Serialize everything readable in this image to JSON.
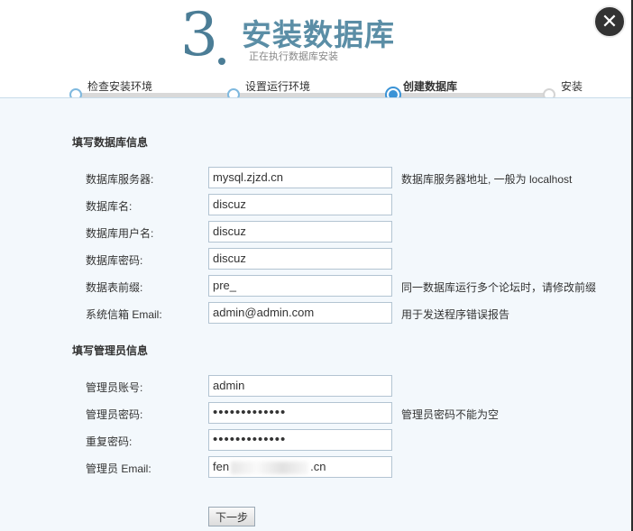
{
  "header": {
    "step_number": "3",
    "title": "安装数据库",
    "subtitle": "正在执行数据库安装",
    "close_icon": "close-icon"
  },
  "steps": [
    {
      "label": "检查安装环境",
      "state": "done"
    },
    {
      "label": "设置运行环境",
      "state": "done"
    },
    {
      "label": "创建数据库",
      "state": "current"
    },
    {
      "label": "安装",
      "state": "todo"
    }
  ],
  "db_section": {
    "title": "填写数据库信息",
    "fields": [
      {
        "label": "数据库服务器:",
        "value": "mysql.zjzd.cn",
        "hint": "数据库服务器地址, 一般为 localhost"
      },
      {
        "label": "数据库名:",
        "value": "discuz",
        "hint": ""
      },
      {
        "label": "数据库用户名:",
        "value": "discuz",
        "hint": ""
      },
      {
        "label": "数据库密码:",
        "value": "discuz",
        "hint": ""
      },
      {
        "label": "数据表前缀:",
        "value": "pre_",
        "hint": "同一数据库运行多个论坛时，请修改前缀"
      },
      {
        "label": "系统信箱 Email:",
        "value": "admin@admin.com",
        "hint": "用于发送程序错误报告"
      }
    ]
  },
  "admin_section": {
    "title": "填写管理员信息",
    "fields": [
      {
        "label": "管理员账号:",
        "value": "admin",
        "hint": ""
      },
      {
        "label": "管理员密码:",
        "value": "•••••••••••••",
        "hint": "管理员密码不能为空"
      },
      {
        "label": "重复密码:",
        "value": "•••••••••••••",
        "hint": ""
      },
      {
        "label": "管理员 Email:",
        "value_prefix": "fen",
        "value_suffix": ".cn",
        "hint": ""
      }
    ]
  },
  "next_button": "下一步"
}
